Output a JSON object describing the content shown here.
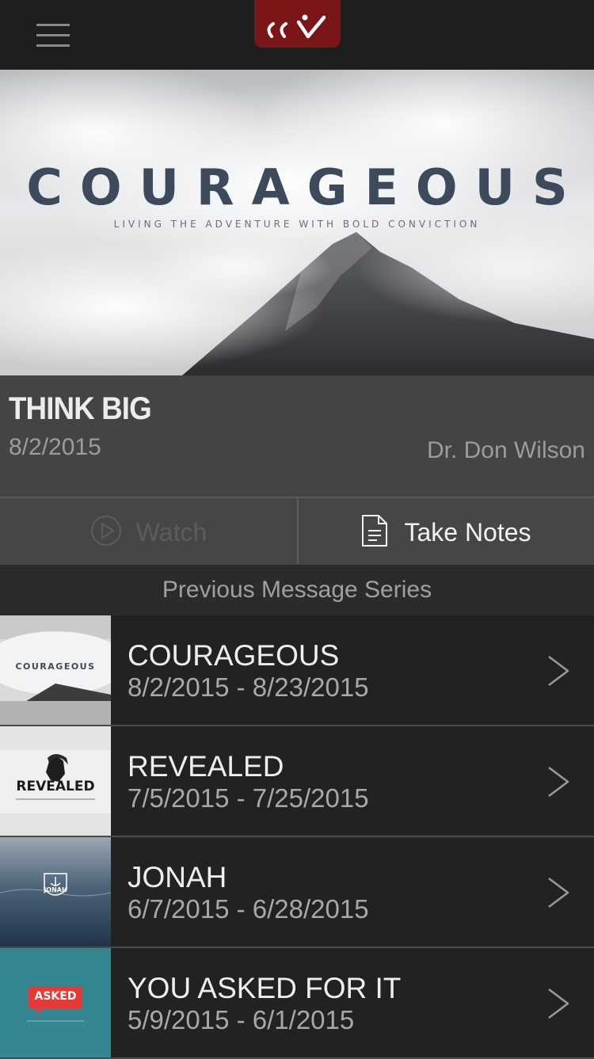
{
  "header": {
    "menu_icon": "hamburger-menu-icon",
    "logo_text": "ccv",
    "logo_color": "#7a1518"
  },
  "hero": {
    "title": "COURAGEOUS",
    "subtitle": "LIVING THE ADVENTURE WITH BOLD CONVICTION"
  },
  "message": {
    "title": "THINK BIG",
    "date": "8/2/2015",
    "speaker": "Dr. Don Wilson"
  },
  "actions": {
    "watch_label": "Watch",
    "watch_icon": "play-circle-icon",
    "notes_label": "Take Notes",
    "notes_icon": "document-icon"
  },
  "previous": {
    "header": "Previous Message Series",
    "items": [
      {
        "name": "COURAGEOUS",
        "dates": "8/2/2015 - 8/23/2015",
        "thumb_text": "COURAGEOUS"
      },
      {
        "name": "REVEALED",
        "dates": "7/5/2015 - 7/25/2015",
        "thumb_text": "REVEALED"
      },
      {
        "name": "JONAH",
        "dates": "6/7/2015 - 6/28/2015",
        "thumb_text": "JONAH"
      },
      {
        "name": "YOU ASKED FOR IT",
        "dates": "5/9/2015 - 6/1/2015",
        "thumb_text": "ASKED"
      }
    ]
  }
}
